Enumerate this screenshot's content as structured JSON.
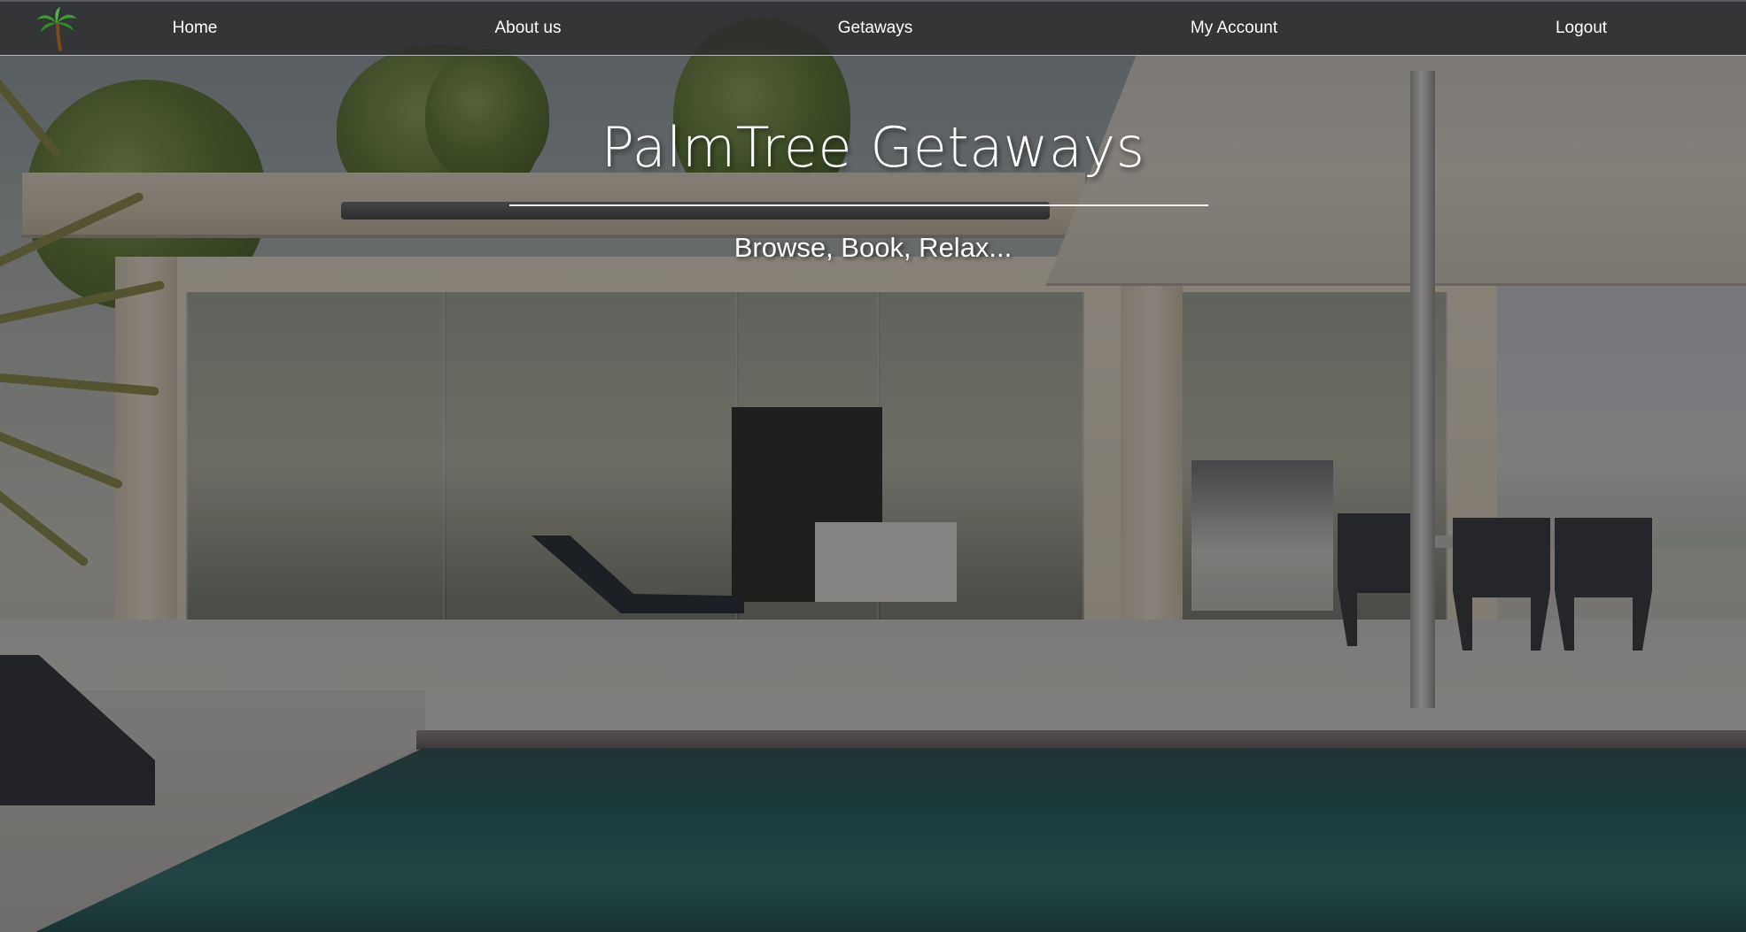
{
  "nav": {
    "logo_icon": "palm-tree-icon",
    "items": [
      {
        "label": "Home"
      },
      {
        "label": "About us"
      },
      {
        "label": "Getaways"
      },
      {
        "label": "My Account"
      },
      {
        "label": "Logout"
      }
    ]
  },
  "hero": {
    "title": "PalmTree Getaways",
    "tagline": "Browse, Book, Relax...",
    "background": "modern-villa-with-pool-photo"
  },
  "colors": {
    "nav_background": "#2c2c2e",
    "text": "#ffffff",
    "pool": "#1f5a5b"
  }
}
